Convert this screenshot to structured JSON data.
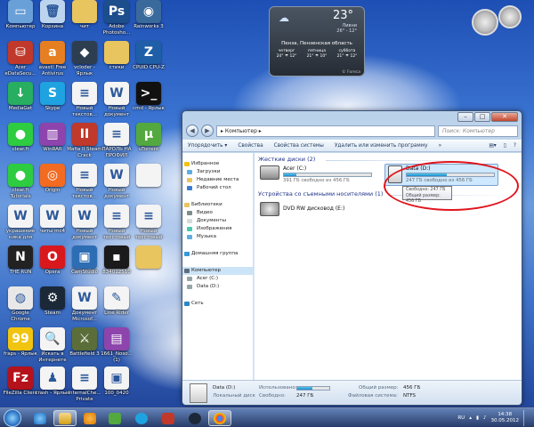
{
  "desktop": {
    "icons": [
      {
        "label": "Компьютер",
        "icon": "computer-icon",
        "color": "#6aa0d8",
        "glyph": "▭"
      },
      {
        "label": "Корзина",
        "icon": "recycle-bin-icon",
        "color": "#bcd4ee",
        "glyph": "🗑"
      },
      {
        "label": "чит",
        "icon": "folder-icon",
        "color": "#e8c55e",
        "glyph": ""
      },
      {
        "label": "Adobe Photosho...",
        "icon": "photoshop-icon",
        "color": "#1c4e8c",
        "glyph": "Ps"
      },
      {
        "label": "Rainworks 3",
        "icon": "rainmeter-icon",
        "color": "#3a6a9c",
        "glyph": "◉"
      },
      {
        "label": "Acer eDataSecu...",
        "icon": "acer-security-icon",
        "color": "#c0392b",
        "glyph": "⛁"
      },
      {
        "label": "avast! Free Antivirus",
        "icon": "avast-icon",
        "color": "#e67e22",
        "glyph": "a"
      },
      {
        "label": "vcloder - Ярлык",
        "icon": "vcloder-icon",
        "color": "#2c3e50",
        "glyph": "◆"
      },
      {
        "label": "стики",
        "icon": "stiki-folder-icon",
        "color": "#e8c55e",
        "glyph": ""
      },
      {
        "label": "CPUID CPU-Z",
        "icon": "cpuz-icon",
        "color": "#1f5fa8",
        "glyph": "Z"
      },
      {
        "label": "MediaGet",
        "icon": "mediaget-icon",
        "color": "#27ae60",
        "glyph": "↓"
      },
      {
        "label": "Skype",
        "icon": "skype-icon",
        "color": "#1fa3e0",
        "glyph": "S"
      },
      {
        "label": "Новый текстов...",
        "icon": "text-document-icon",
        "color": "#f4f4f4",
        "glyph": "≡"
      },
      {
        "label": "Новый документ",
        "icon": "word-document-icon",
        "color": "#f4f4f4",
        "glyph": "W"
      },
      {
        "label": "cmd - Ярлык",
        "icon": "cmd-icon",
        "color": "#111111",
        "glyph": ">_"
      },
      {
        "label": "clear.fi",
        "icon": "clearfi-icon",
        "color": "#2ecc40",
        "glyph": "●"
      },
      {
        "label": "WinRAR",
        "icon": "winrar-icon",
        "color": "#8e44ad",
        "glyph": "▥"
      },
      {
        "label": "Mafia II Steam Crack",
        "icon": "mafia-icon",
        "color": "#c0392b",
        "glyph": "II"
      },
      {
        "label": "ПАРОЛЬ НА ПРОФИЛ",
        "icon": "password-document-icon",
        "color": "#f4f4f4",
        "glyph": "≡"
      },
      {
        "label": "uTorrent",
        "icon": "utorrent-icon",
        "color": "#53a93f",
        "glyph": "µ"
      },
      {
        "label": "clear.fi Tutorials",
        "icon": "clearfi-tutorials-icon",
        "color": "#2ecc40",
        "glyph": "●"
      },
      {
        "label": "Origin",
        "icon": "origin-icon",
        "color": "#f26b21",
        "glyph": "◎"
      },
      {
        "label": "Новый текстов...",
        "icon": "text-document-icon",
        "color": "#f4f4f4",
        "glyph": "≡"
      },
      {
        "label": "Новый документ",
        "icon": "word-document-icon",
        "color": "#f4f4f4",
        "glyph": "W"
      },
      {
        "label": "",
        "icon": "blank-document-icon",
        "color": "#f4f4f4",
        "glyph": ""
      },
      {
        "label": "украшение ника для",
        "icon": "nick-decoration-document-icon",
        "color": "#f4f4f4",
        "glyph": "W"
      },
      {
        "label": "читы mc4",
        "icon": "cheats-document-icon",
        "color": "#f4f4f4",
        "glyph": "W"
      },
      {
        "label": "Новый документ",
        "icon": "word-document-icon",
        "color": "#f4f4f4",
        "glyph": "W"
      },
      {
        "label": "Новый текстовый",
        "icon": "text-document-icon",
        "color": "#f4f4f4",
        "glyph": "≡"
      },
      {
        "label": "Новый текстовый",
        "icon": "text-document-icon",
        "color": "#f4f4f4",
        "glyph": "≡"
      },
      {
        "label": "THE RUN",
        "icon": "nfs-the-run-icon",
        "color": "#222222",
        "glyph": "N"
      },
      {
        "label": "Opera",
        "icon": "opera-icon",
        "color": "#d9181e",
        "glyph": "O"
      },
      {
        "label": "CamStudio",
        "icon": "camstudio-icon",
        "color": "#2d6db3",
        "glyph": "▣"
      },
      {
        "label": "834012510",
        "icon": "image-file-icon",
        "color": "#1b1b1b",
        "glyph": "▪"
      },
      {
        "label": "",
        "icon": "folder-icon",
        "color": "#e8c55e",
        "glyph": ""
      },
      {
        "label": "Google Chrome",
        "icon": "chrome-icon",
        "color": "#e8e8e8",
        "glyph": "◍"
      },
      {
        "label": "Steam",
        "icon": "steam-icon",
        "color": "#1b2838",
        "glyph": "⚙"
      },
      {
        "label": "Документ Microsof...",
        "icon": "ms-document-icon",
        "color": "#f4f4f4",
        "glyph": "W"
      },
      {
        "label": "Line Rider",
        "icon": "line-rider-icon",
        "color": "#f4f4f4",
        "glyph": "✎"
      },
      {
        "label": "",
        "icon": "empty-slot",
        "color": "transparent",
        "glyph": ""
      },
      {
        "label": "fraps - Ярлык",
        "icon": "fraps-icon",
        "color": "#f1c40f",
        "glyph": "99"
      },
      {
        "label": "Искать в Интернете",
        "icon": "search-internet-icon",
        "color": "#f4f4f4",
        "glyph": "🔍"
      },
      {
        "label": "Battlefield 3",
        "icon": "battlefield-icon",
        "color": "#5b6e3a",
        "glyph": "⚔"
      },
      {
        "label": "1661_Noso... (1)",
        "icon": "archive-icon",
        "color": "#8e44ad",
        "glyph": "▤"
      },
      {
        "label": "",
        "icon": "empty-slot",
        "color": "transparent",
        "glyph": ""
      },
      {
        "label": "FileZilla Client",
        "icon": "filezilla-icon",
        "color": "#b5121b",
        "glyph": "Fz"
      },
      {
        "label": "crash - Ярлык",
        "icon": "crash-icon",
        "color": "#f4f4f4",
        "glyph": "♟"
      },
      {
        "label": "InternalChe... Private",
        "icon": "internal-cheat-icon",
        "color": "#f4f4f4",
        "glyph": "≡"
      },
      {
        "label": "100_0420",
        "icon": "photo-icon",
        "color": "#f4f4f4",
        "glyph": "▣"
      }
    ]
  },
  "weather": {
    "temperature": "23°",
    "condition": "Ливни",
    "hi_lo": "26° - 12°",
    "city": "Пенза, Пензенская область",
    "days": [
      {
        "name": "четверг",
        "hi": "24°",
        "lo": "12°"
      },
      {
        "name": "пятница",
        "hi": "21°",
        "lo": "10°"
      },
      {
        "name": "суббота",
        "hi": "21°",
        "lo": "12°"
      }
    ],
    "credit": "© Foreca"
  },
  "window": {
    "address": "Компьютер",
    "search_placeholder": "Поиск: Компьютер",
    "toolbar": {
      "organize": "Упорядочить ▾",
      "properties": "Свойства",
      "system_properties": "Свойства системы",
      "uninstall": "Удалить или изменить программу",
      "more": "»"
    },
    "nav": {
      "favorites": "Избранное",
      "downloads": "Загрузки",
      "recent": "Недавние места",
      "desktop": "Рабочий стол",
      "libraries": "Библиотеки",
      "video": "Видео",
      "documents": "Документы",
      "images": "Изображения",
      "music": "Музыка",
      "homegroup": "Домашняя группа",
      "computer": "Компьютер",
      "acer": "Acer (C:)",
      "data": "Data (D:)",
      "network": "Сеть"
    },
    "groups": {
      "hard_disks": "Жесткие диски (2)",
      "removable": "Устройства со съемными носителями (1)"
    },
    "drives": {
      "c": {
        "name": "Acer (C:)",
        "free": "391 ГБ свободно из 456 ГБ",
        "used_fraction": 0.14
      },
      "d": {
        "name": "Data (D:)",
        "free": "247 ГБ свободно из 456 ГБ",
        "used_fraction": 0.46
      },
      "dvd": {
        "name": "DVD RW дисковод (E:)"
      }
    },
    "tooltip": {
      "free": "Свободно: 247 ГБ",
      "total": "Общий размер: 456 ГБ"
    },
    "details": {
      "name": "Data (D:)",
      "type": "Локальный диск",
      "used_label": "Использовано:",
      "free_label": "Свободно:",
      "free_value": "247 ГБ",
      "total_label": "Общий размер:",
      "total_value": "456 ГБ",
      "fs_label": "Файловая система:",
      "fs_value": "NTFS"
    }
  },
  "taskbar": {
    "language": "RU",
    "time": "14:38",
    "date": "30.05.2012"
  }
}
